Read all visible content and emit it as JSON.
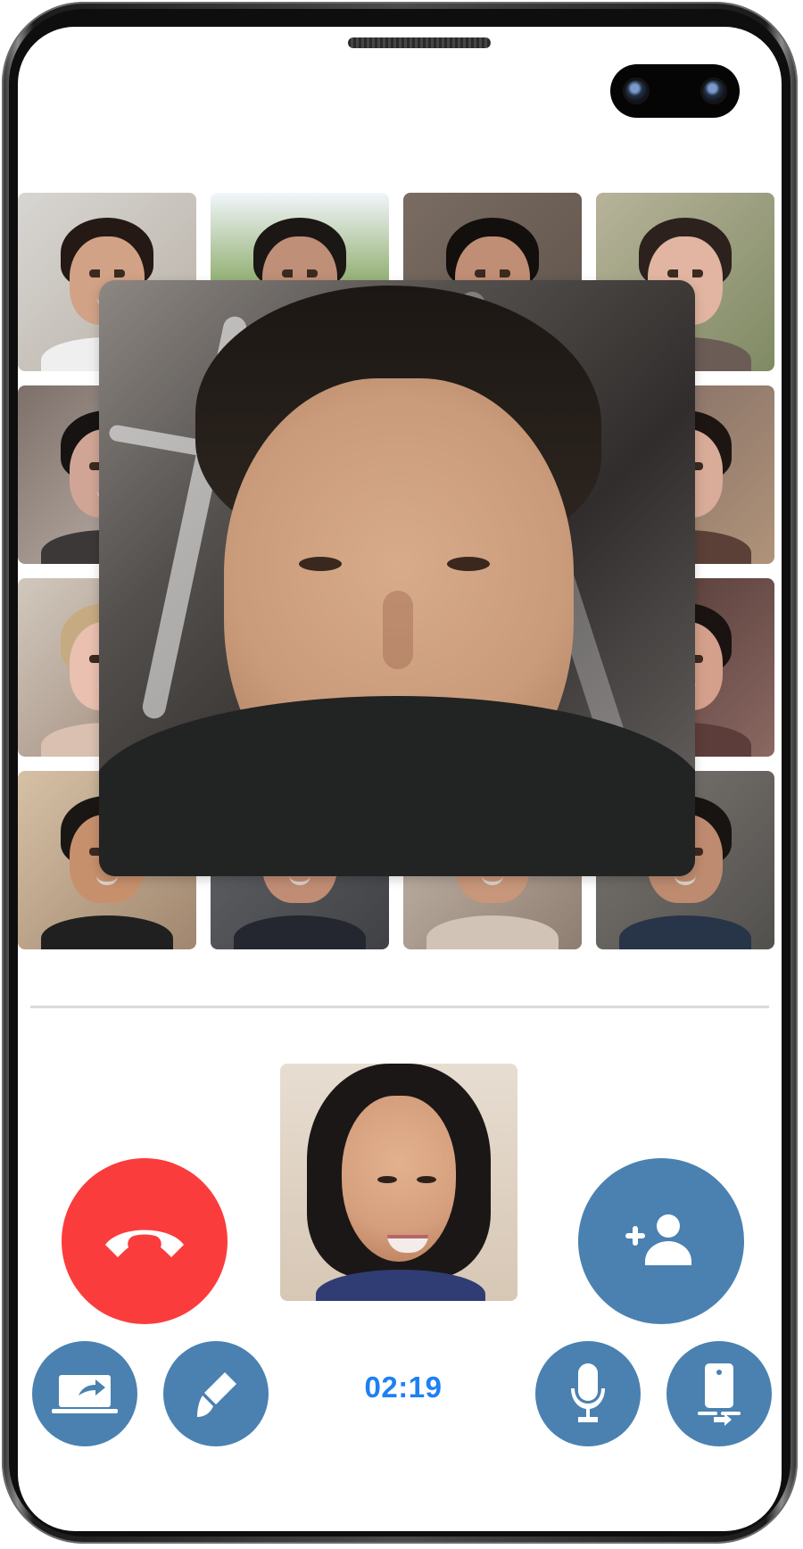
{
  "call": {
    "timer": "02:19"
  },
  "controls": {
    "end_call_icon": "phone-hangup-icon",
    "add_user_icon": "add-user-icon",
    "share_screen_icon": "share-screen-icon",
    "paint_icon": "paint-brush-icon",
    "mic_icon": "microphone-icon",
    "device_icon": "device-switch-icon"
  },
  "theme": {
    "accent": "#4a81b0",
    "danger": "#fb3c3c",
    "timer": "#1e80f3"
  }
}
